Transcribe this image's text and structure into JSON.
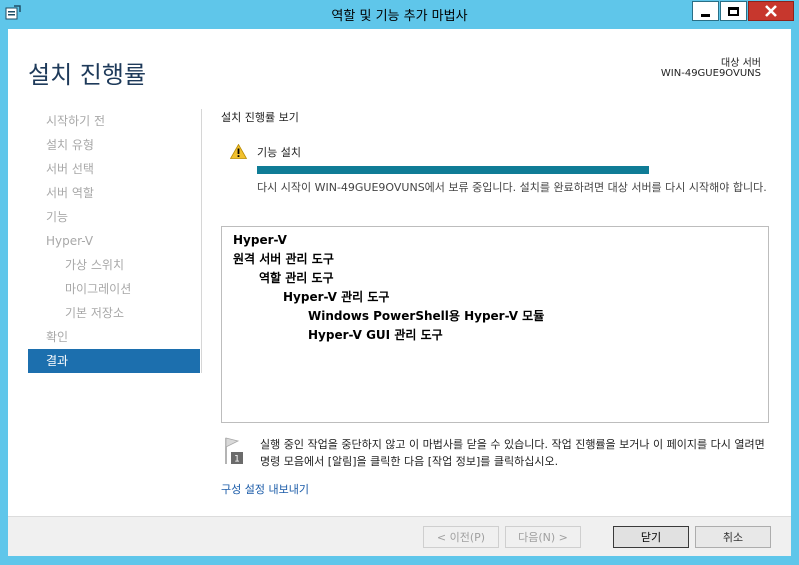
{
  "window": {
    "title": "역할 및 기능 추가 마법사",
    "accent": "#5fc6ea"
  },
  "header": {
    "page_title": "설치 진행률",
    "server_label": "대상 서버",
    "server_name": "WIN-49GUE9OVUNS"
  },
  "nav": {
    "items": [
      {
        "label": "시작하기 전"
      },
      {
        "label": "설치 유형"
      },
      {
        "label": "서버 선택"
      },
      {
        "label": "서버 역할"
      },
      {
        "label": "기능"
      },
      {
        "label": "Hyper-V"
      },
      {
        "label": "가상 스위치"
      },
      {
        "label": "마이그레이션"
      },
      {
        "label": "기본 저장소"
      },
      {
        "label": "확인"
      },
      {
        "label": "결과"
      }
    ],
    "active_color": "#1c6fae"
  },
  "content": {
    "section_title": "설치 진행률 보기",
    "status_label": "기능 설치",
    "progress": 1.0,
    "progress_color": "#0f7c96",
    "pending_text": "다시 시작이 WIN-49GUE9OVUNS에서 보류 중입니다. 설치를 완료하려면 대상 서버를 다시 시작해야 합니다.",
    "results": [
      {
        "text": "Hyper-V"
      },
      {
        "text": "원격 서버 관리 도구"
      },
      {
        "text": "역할 관리 도구"
      },
      {
        "text": "Hyper-V 관리 도구"
      },
      {
        "text": "Windows PowerShell용 Hyper-V 모듈"
      },
      {
        "text": "Hyper-V GUI 관리 도구"
      }
    ],
    "info_badge": "1",
    "info_text": "실행 중인 작업을 중단하지 않고 이 마법사를 닫을 수 있습니다. 작업 진행률을 보거나 이 페이지를 다시 열려면 명령 모음에서 [알림]을 클릭한 다음 [작업 정보]를 클릭하십시오.",
    "export_link": "구성 설정 내보내기"
  },
  "footer": {
    "prev": "< 이전(P)",
    "next": "다음(N) >",
    "close": "닫기",
    "cancel": "취소"
  }
}
